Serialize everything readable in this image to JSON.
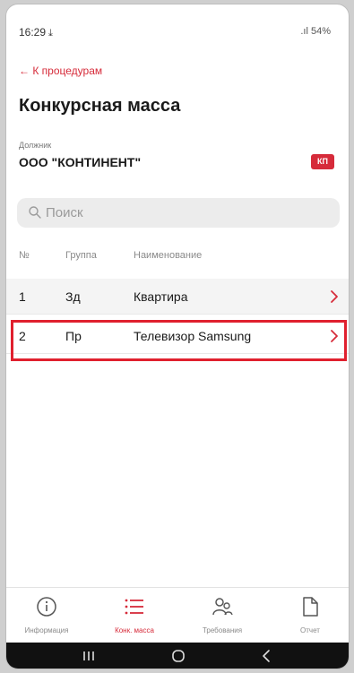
{
  "status_bar": {
    "time": "16:29",
    "download_icon": "download-arrow-icon",
    "indicators": "  .ıl 54%"
  },
  "nav": {
    "back_label": "← К процедурам"
  },
  "page": {
    "title": "Конкурсная масса"
  },
  "debtor": {
    "label": "Должник",
    "name": "ООО \"КОНТИНЕНТ\"",
    "badge": "КП"
  },
  "search": {
    "placeholder": "Поиск"
  },
  "table": {
    "columns": [
      "№",
      "Группа",
      "Наименование"
    ],
    "rows": [
      {
        "num": "1",
        "group": "Зд",
        "name": "Квартира"
      },
      {
        "num": "2",
        "group": "Пр",
        "name": "Телевизор Samsung"
      }
    ]
  },
  "tabs": [
    {
      "label": "Информация",
      "icon": "info-icon"
    },
    {
      "label": "Конк. масса",
      "icon": "list-icon",
      "active": true
    },
    {
      "label": "Требования",
      "icon": "users-icon"
    },
    {
      "label": "Отчет",
      "icon": "document-icon"
    }
  ],
  "colors": {
    "accent": "#d62b3a",
    "highlight_border": "#e0202e"
  }
}
